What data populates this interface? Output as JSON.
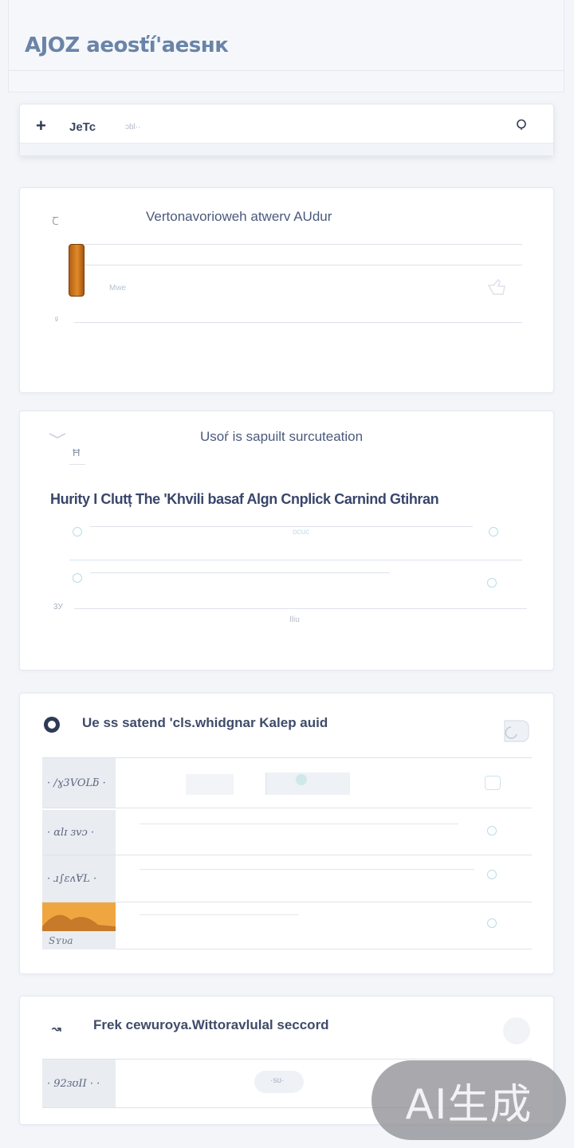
{
  "app": {
    "title": "AJOZ aeosťí'aesнк"
  },
  "search": {
    "icon": "plus-icon",
    "text": "JeTc",
    "hint": "ɔbl··",
    "search_icon": "search-icon"
  },
  "card1": {
    "title": "Vertonavorioweh atwerv AUdur",
    "corner_label": "Ꞇ",
    "faint_label": "Mwe",
    "axis_label": "ᵍ",
    "progress": 0.12
  },
  "card2": {
    "title": "Usoŕ is sapuilt surcuteation",
    "side_tick": "Ħ",
    "heading": "Hurity I Clutț The 'Khvili basaf Algn Cnplick Carnind Gtihran",
    "axis_label": "3У",
    "bottom_label": "Iliu",
    "mid_label": "ocuc"
  },
  "card3": {
    "title": "Ue ss satend 'cls.whidgnar Kalep auid",
    "rows": [
      {
        "label": "· /ɣ3VOLƃ ·"
      },
      {
        "label": "· ɑlɪ ɜvɔ ·"
      },
      {
        "label": "· ɹ∫ɛʌⱯL ·"
      },
      {
        "label": "Sʏʋa"
      }
    ]
  },
  "card4": {
    "title": "Frek cewuroya.Wittoravlulal seccord",
    "rows": [
      {
        "label": "· 92ɜʊII · ·",
        "pill": "·sʊ·"
      }
    ]
  },
  "watermark": {
    "text": "AI生成"
  }
}
